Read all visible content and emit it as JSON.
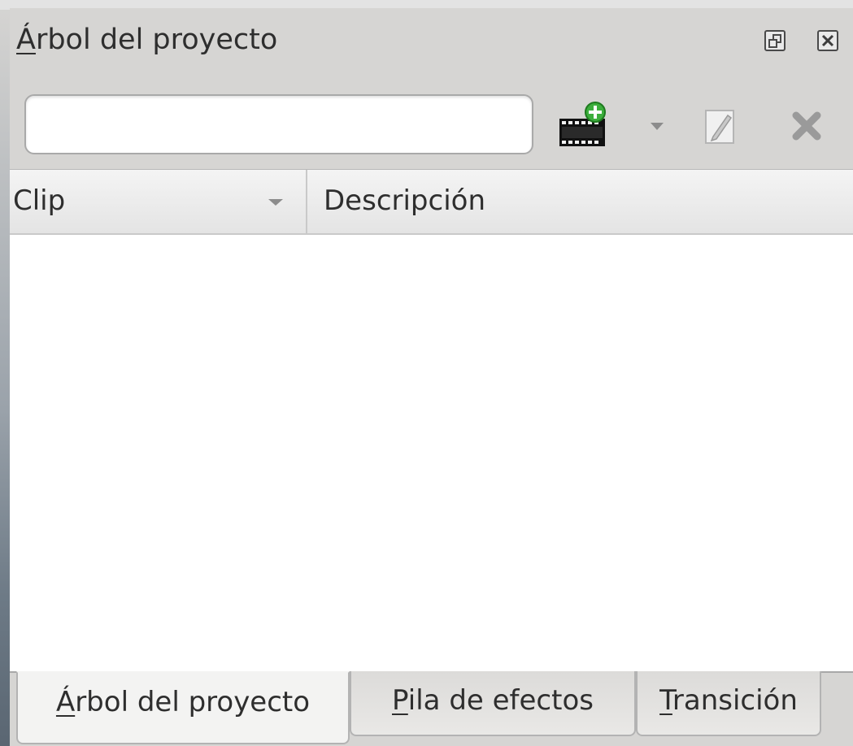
{
  "window": {
    "title_initial": "Á",
    "title_rest": "rbol del proyecto"
  },
  "toolbar": {
    "search": {
      "value": "",
      "placeholder": ""
    },
    "buttons": [
      {
        "name": "add-clip",
        "icon": "film-add-icon"
      },
      {
        "name": "add-clip-menu",
        "icon": "chevron-down-icon"
      },
      {
        "name": "edit-clip",
        "icon": "edit-icon"
      },
      {
        "name": "delete-clip",
        "icon": "delete-icon"
      }
    ]
  },
  "table": {
    "columns": [
      {
        "label": "Clip",
        "sorted": "descending"
      },
      {
        "label": "Descripción"
      }
    ],
    "rows": []
  },
  "tabs": [
    {
      "initial": "Á",
      "rest": "rbol del proyecto",
      "active": true
    },
    {
      "initial": "P",
      "rest": "ila de efectos",
      "active": false
    },
    {
      "initial": "T",
      "rest": "ransición",
      "active": false
    }
  ],
  "colors": {
    "panel_bg": "#d6d5d3",
    "list_bg": "#ffffff",
    "add_badge": "#3cae3c",
    "icon_gray": "#8c8c8c"
  }
}
